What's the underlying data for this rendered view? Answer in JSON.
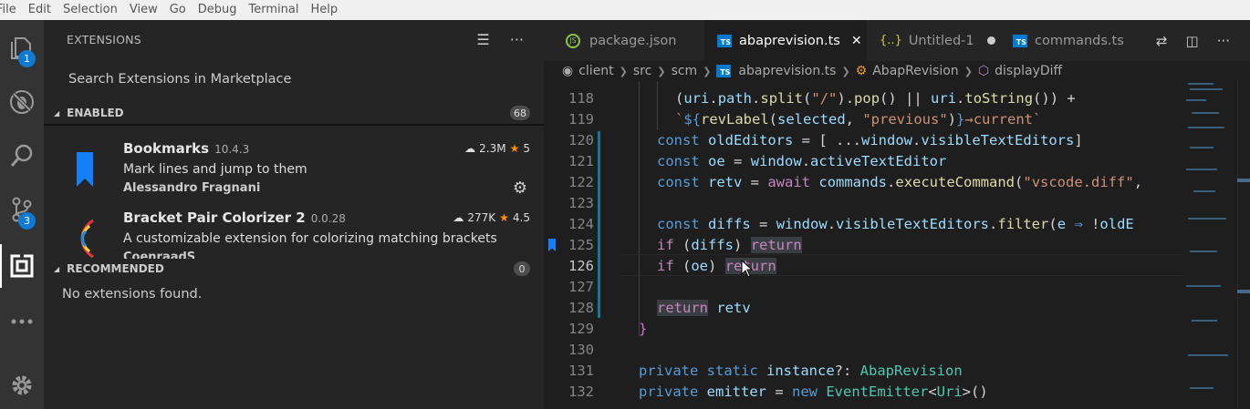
{
  "menu": [
    "File",
    "Edit",
    "Selection",
    "View",
    "Go",
    "Debug",
    "Terminal",
    "Help"
  ],
  "activity": {
    "explorer_badge": "1",
    "scm_badge": "3"
  },
  "sidebar": {
    "title": "EXTENSIONS",
    "search_placeholder": "Search Extensions in Marketplace",
    "enabled_label": "ENABLED",
    "enabled_count": "68",
    "recommended_label": "RECOMMENDED",
    "recommended_count": "0",
    "no_extensions": "No extensions found.",
    "extensions": [
      {
        "name": "Bookmarks",
        "version": "10.4.3",
        "downloads": "2.3M",
        "rating": "5",
        "description": "Mark lines and jump to them",
        "author": "Alessandro Fragnani"
      },
      {
        "name": "Bracket Pair Colorizer 2",
        "version": "0.0.28",
        "downloads": "277K",
        "rating": "4.5",
        "description": "A customizable extension for colorizing matching brackets",
        "author": "CoenraadS"
      }
    ]
  },
  "tabs": [
    {
      "label": "package.json",
      "icon": "json-icon",
      "active": false
    },
    {
      "label": "abaprevision.ts",
      "icon": "typescript-icon",
      "active": true
    },
    {
      "label": "Untitled-1",
      "icon": "braces-icon",
      "active": false
    },
    {
      "label": "commands.ts",
      "icon": "typescript-icon",
      "active": false
    }
  ],
  "breadcrumbs": [
    "client",
    "src",
    "scm",
    "abaprevision.ts",
    "AbapRevision",
    "displayDiff"
  ],
  "code": {
    "line_numbers": [
      "118",
      "119",
      "120",
      "121",
      "122",
      "123",
      "124",
      "125",
      "126",
      "127",
      "128",
      "129",
      "130",
      "131",
      "132"
    ]
  },
  "colors": {
    "accent": "#007acc",
    "badge": "#0e7ad3",
    "star": "#ff8e00"
  }
}
